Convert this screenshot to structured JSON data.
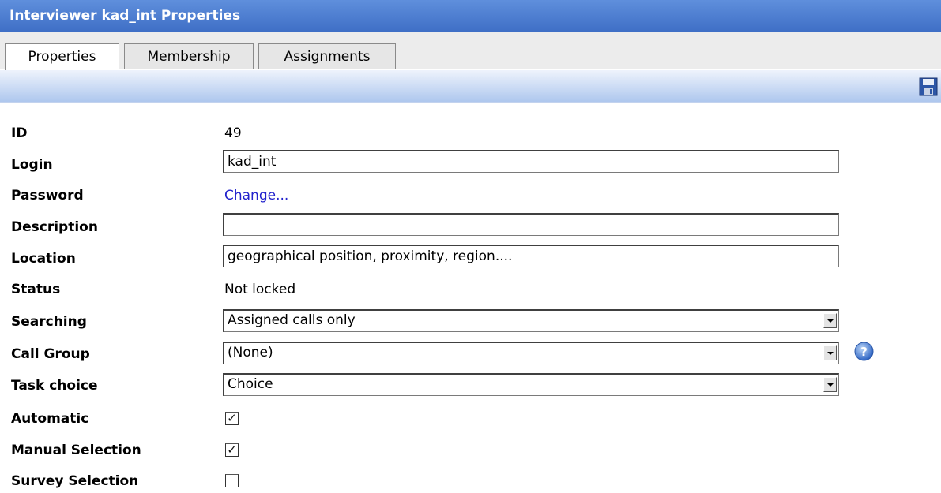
{
  "window": {
    "title": "Interviewer kad_int Properties"
  },
  "tabs": [
    {
      "label": "Properties",
      "active": true
    },
    {
      "label": "Membership",
      "active": false
    },
    {
      "label": "Assignments",
      "active": false
    }
  ],
  "toolbar": {
    "save_icon": "floppy-disk-save-icon"
  },
  "form": {
    "id": {
      "label": "ID",
      "value": "49"
    },
    "login": {
      "label": "Login",
      "value": "kad_int"
    },
    "password": {
      "label": "Password",
      "link": "Change..."
    },
    "description": {
      "label": "Description",
      "value": ""
    },
    "location": {
      "label": "Location",
      "value": "geographical position, proximity, region...."
    },
    "status": {
      "label": "Status",
      "value": "Not locked"
    },
    "searching": {
      "label": "Searching",
      "value": "Assigned calls only"
    },
    "call_group": {
      "label": "Call Group",
      "value": "(None)",
      "help_icon": "help-question-icon"
    },
    "task_choice": {
      "label": "Task choice",
      "value": "Choice"
    },
    "automatic": {
      "label": "Automatic",
      "checked": true
    },
    "manual_selection": {
      "label": "Manual Selection",
      "checked": true
    },
    "survey_selection": {
      "label": "Survey Selection",
      "checked": false
    }
  },
  "colors": {
    "title_bar": "#4a7ad2",
    "link": "#2222cc",
    "toolbar": "#c0d4f2"
  }
}
